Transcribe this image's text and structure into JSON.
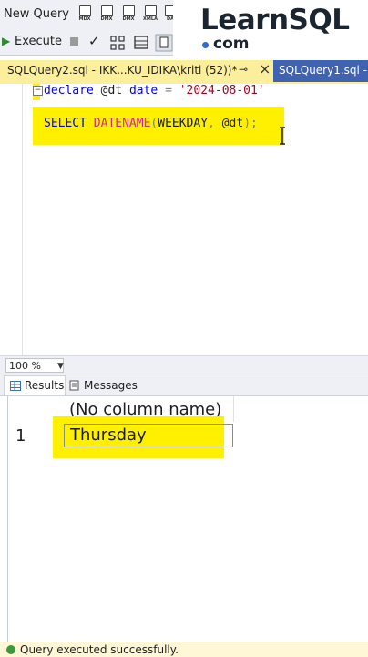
{
  "toolbar": {
    "new_query_label": "New Query",
    "mini_icons": [
      "MDX",
      "DMX",
      "XMLA",
      "DA"
    ],
    "execute_label": "Execute"
  },
  "logo": {
    "name": "LearnSQL",
    "domain": "com"
  },
  "tabs": [
    {
      "label": "SQLQuery2.sql - IKK...KU_IDIKA\\kriti (52))*",
      "active": true
    },
    {
      "label": "SQLQuery1.sql - ",
      "active": false
    }
  ],
  "tab_pin": "⊸",
  "tab_close": "×",
  "editor": {
    "line1": {
      "kw1": "declare",
      "var": " @dt ",
      "kw2": "date",
      "op": " = ",
      "str": "'2024-08-01'"
    },
    "line2": {
      "kw1": "SELECT",
      "sp": " ",
      "fn": "DATENAME",
      "open": "(",
      "arg1": "WEEKDAY",
      "sep": ", ",
      "arg2": "@dt",
      "close": ");"
    }
  },
  "zoom_level": "100 %",
  "results_tabs": {
    "results_label": "Results",
    "messages_label": "Messages"
  },
  "grid": {
    "column_header": "(No column name)",
    "rows": [
      {
        "row_number": "1",
        "value": "Thursday"
      }
    ]
  },
  "status": {
    "message": "Query executed successfully."
  },
  "colors": {
    "highlight": "#fff000",
    "active_tab": "#fcef9b",
    "inactive_tab": "#3f63b0",
    "keyword": "#0000ff",
    "function": "#d62a8c",
    "string": "#b8001f"
  }
}
